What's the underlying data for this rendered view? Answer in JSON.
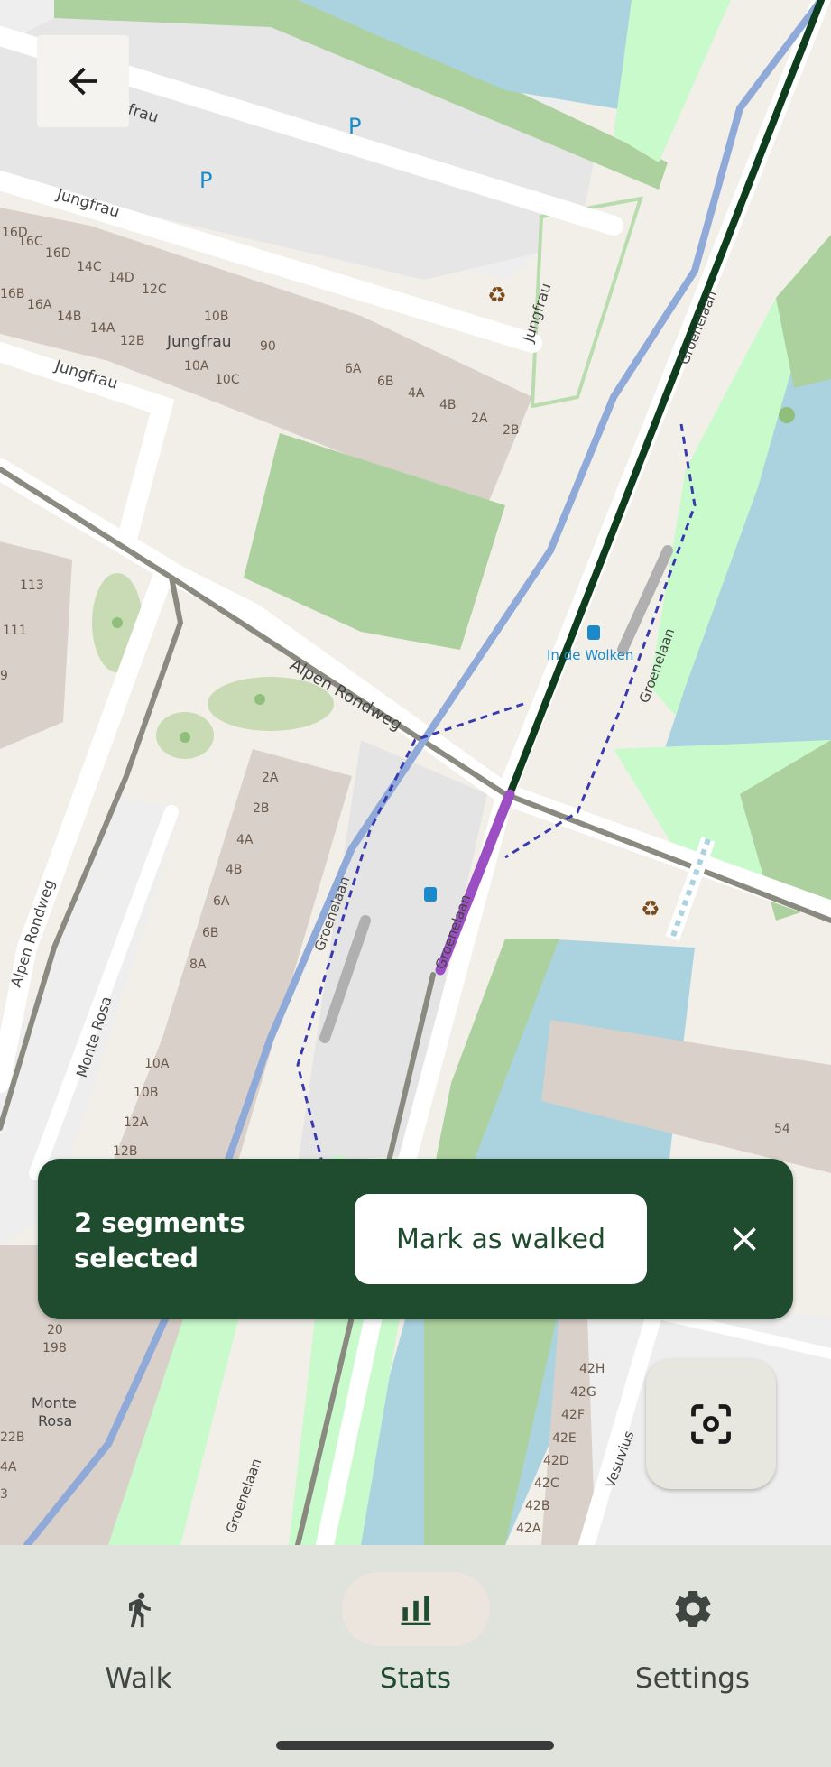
{
  "map": {
    "street_labels": {
      "jungfrau_top": "Jungfrau",
      "jungfrau_mid": "Jungfrau",
      "jungfrau_lower": "Jungfrau",
      "jungfrau_vertical": "Jungfrau",
      "jungfrau_inner": "Jungfrau",
      "groenelaan_top": "Groenelaan",
      "groenelaan_right": "Groenelaan",
      "groenelaan_mid": "Groenelaan",
      "groenelaan_selected": "Groenelaan",
      "groenelaan_bottom": "Groenelaan",
      "alpen_rondweg": "Alpen Rondweg",
      "alpen_rondweg_left": "Alpen Rondweg",
      "monte_rosa": "Monte Rosa",
      "monte_rosa_bottom": "Monte\nRosa",
      "vesuvius": "Vesuvius",
      "bus_stop": "In de Wolken"
    },
    "parking_marker": "P",
    "recycling_marker": "♻",
    "house_numbers_top": [
      "16D",
      "16C",
      "16D",
      "14C",
      "14D",
      "12C",
      "16B",
      "16A",
      "14B",
      "14A",
      "12B",
      "10B",
      "10A",
      "10C",
      "90",
      "6A",
      "6B",
      "4A",
      "4B",
      "2A",
      "2B"
    ],
    "house_numbers_left": [
      "113",
      "111",
      "9"
    ],
    "house_numbers_block": [
      "2A",
      "2B",
      "4A",
      "4B",
      "6A",
      "6B",
      "8A",
      "10A",
      "10B",
      "12A",
      "12B"
    ],
    "house_numbers_bottom_left": [
      "20",
      "198",
      "22B",
      "4A",
      "3"
    ],
    "house_numbers_right": [
      "42H",
      "42G",
      "42F",
      "42E",
      "42D",
      "42C",
      "42B",
      "42A"
    ],
    "house_number_54": "54",
    "colors": {
      "selected_segment": "#9b4fc3",
      "walked_route": "#0d3d1c",
      "tram_line": "#8fa9d8",
      "water": "#aad3df",
      "park": "#add19e",
      "building": "#d9d0c9"
    }
  },
  "snackbar": {
    "message": "2 segments selected",
    "action_label": "Mark as walked"
  },
  "bottom_nav": {
    "items": [
      {
        "label": "Walk",
        "icon": "walk-icon",
        "active": false
      },
      {
        "label": "Stats",
        "icon": "bar-chart-icon",
        "active": true
      },
      {
        "label": "Settings",
        "icon": "gear-icon",
        "active": false
      }
    ]
  }
}
